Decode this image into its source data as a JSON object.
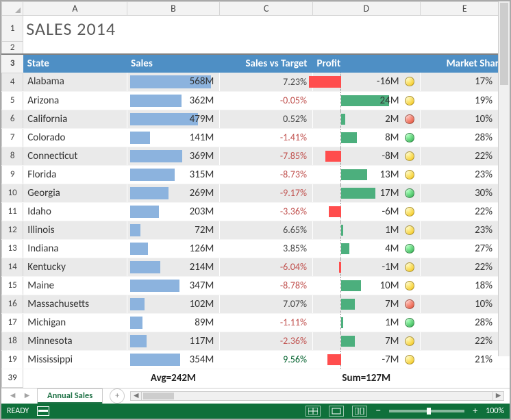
{
  "title": "SALES 2014",
  "columns": [
    "A",
    "B",
    "C",
    "D",
    "E"
  ],
  "row_headers_special": {
    "title": "1",
    "slim": "2",
    "header": "3",
    "summary": "39"
  },
  "headers": {
    "state": "State",
    "sales": "Sales",
    "svt": "Sales vs Target",
    "profit": "Profit",
    "share": "Market Share"
  },
  "data_start_row": 4,
  "sales_max": 568,
  "profit_max_abs": 24,
  "rows": [
    {
      "state": "Alabama",
      "sales": 568,
      "svt": 7.23,
      "svt_sign": "neu",
      "profit": -16,
      "light": "yellow",
      "share": 17
    },
    {
      "state": "Arizona",
      "sales": 362,
      "svt": -0.05,
      "svt_sign": "neg",
      "profit": 24,
      "light": "yellow",
      "share": 19
    },
    {
      "state": "California",
      "sales": 479,
      "svt": 0.52,
      "svt_sign": "neu",
      "profit": 2,
      "light": "red",
      "share": 10
    },
    {
      "state": "Colorado",
      "sales": 141,
      "svt": -1.41,
      "svt_sign": "neg",
      "profit": 8,
      "light": "green",
      "share": 28
    },
    {
      "state": "Connecticut",
      "sales": 369,
      "svt": -7.85,
      "svt_sign": "neg",
      "profit": -8,
      "light": "yellow",
      "share": 22
    },
    {
      "state": "Florida",
      "sales": 315,
      "svt": -8.73,
      "svt_sign": "neg",
      "profit": 13,
      "light": "yellow",
      "share": 23
    },
    {
      "state": "Georgia",
      "sales": 269,
      "svt": -9.17,
      "svt_sign": "neg",
      "profit": 17,
      "light": "green",
      "share": 30
    },
    {
      "state": "Idaho",
      "sales": 203,
      "svt": -3.36,
      "svt_sign": "neg",
      "profit": -6,
      "light": "yellow",
      "share": 22
    },
    {
      "state": "Illinois",
      "sales": 72,
      "svt": 6.65,
      "svt_sign": "neu",
      "profit": 1,
      "light": "yellow",
      "share": 23
    },
    {
      "state": "Indiana",
      "sales": 126,
      "svt": 3.85,
      "svt_sign": "neu",
      "profit": 4,
      "light": "green",
      "share": 27
    },
    {
      "state": "Kentucky",
      "sales": 214,
      "svt": -6.04,
      "svt_sign": "neg",
      "profit": -1,
      "light": "yellow",
      "share": 22
    },
    {
      "state": "Maine",
      "sales": 347,
      "svt": -8.78,
      "svt_sign": "neg",
      "profit": 10,
      "light": "yellow",
      "share": 18
    },
    {
      "state": "Massachusetts",
      "sales": 102,
      "svt": 7.07,
      "svt_sign": "neu",
      "profit": 7,
      "light": "red",
      "share": 10
    },
    {
      "state": "Michigan",
      "sales": 89,
      "svt": -1.11,
      "svt_sign": "neg",
      "profit": 1,
      "light": "green",
      "share": 28
    },
    {
      "state": "Minnesota",
      "sales": 117,
      "svt": -2.36,
      "svt_sign": "neg",
      "profit": 7,
      "light": "yellow",
      "share": 22
    },
    {
      "state": "Mississippi",
      "sales": 354,
      "svt": 9.56,
      "svt_sign": "pos",
      "profit": -7,
      "light": "yellow",
      "share": 21
    }
  ],
  "summary": {
    "sales": "Avg=242M",
    "profit": "Sum=127M"
  },
  "sheet_tab": "Annual Sales",
  "status": {
    "ready": "READY",
    "zoom": "100%"
  },
  "chart_data": {
    "type": "table",
    "title": "SALES 2014",
    "columns": [
      "State",
      "Sales (M)",
      "Sales vs Target (%)",
      "Profit (M)",
      "Market Share (%)"
    ],
    "embedded_visuals": {
      "Sales": {
        "type": "bar",
        "range": [
          0,
          568
        ],
        "color": "#8cb3de"
      },
      "Profit": {
        "type": "bar",
        "center": 0,
        "range": [
          -24,
          24
        ],
        "neg_color": "#ff4d4d",
        "pos_color": "#4caf7d",
        "traffic_light": true
      }
    },
    "rows": [
      [
        "Alabama",
        568,
        7.23,
        -16,
        17
      ],
      [
        "Arizona",
        362,
        -0.05,
        24,
        19
      ],
      [
        "California",
        479,
        0.52,
        2,
        10
      ],
      [
        "Colorado",
        141,
        -1.41,
        8,
        28
      ],
      [
        "Connecticut",
        369,
        -7.85,
        -8,
        22
      ],
      [
        "Florida",
        315,
        -8.73,
        13,
        23
      ],
      [
        "Georgia",
        269,
        -9.17,
        17,
        30
      ],
      [
        "Idaho",
        203,
        -3.36,
        -6,
        22
      ],
      [
        "Illinois",
        72,
        6.65,
        1,
        23
      ],
      [
        "Indiana",
        126,
        3.85,
        4,
        27
      ],
      [
        "Kentucky",
        214,
        -6.04,
        -1,
        22
      ],
      [
        "Maine",
        347,
        -8.78,
        10,
        18
      ],
      [
        "Massachusetts",
        102,
        7.07,
        7,
        10
      ],
      [
        "Michigan",
        89,
        -1.11,
        1,
        28
      ],
      [
        "Minnesota",
        117,
        -2.36,
        7,
        22
      ],
      [
        "Mississippi",
        354,
        9.56,
        -7,
        21
      ]
    ],
    "summary": {
      "Sales": "Avg=242M",
      "Profit": "Sum=127M"
    }
  }
}
